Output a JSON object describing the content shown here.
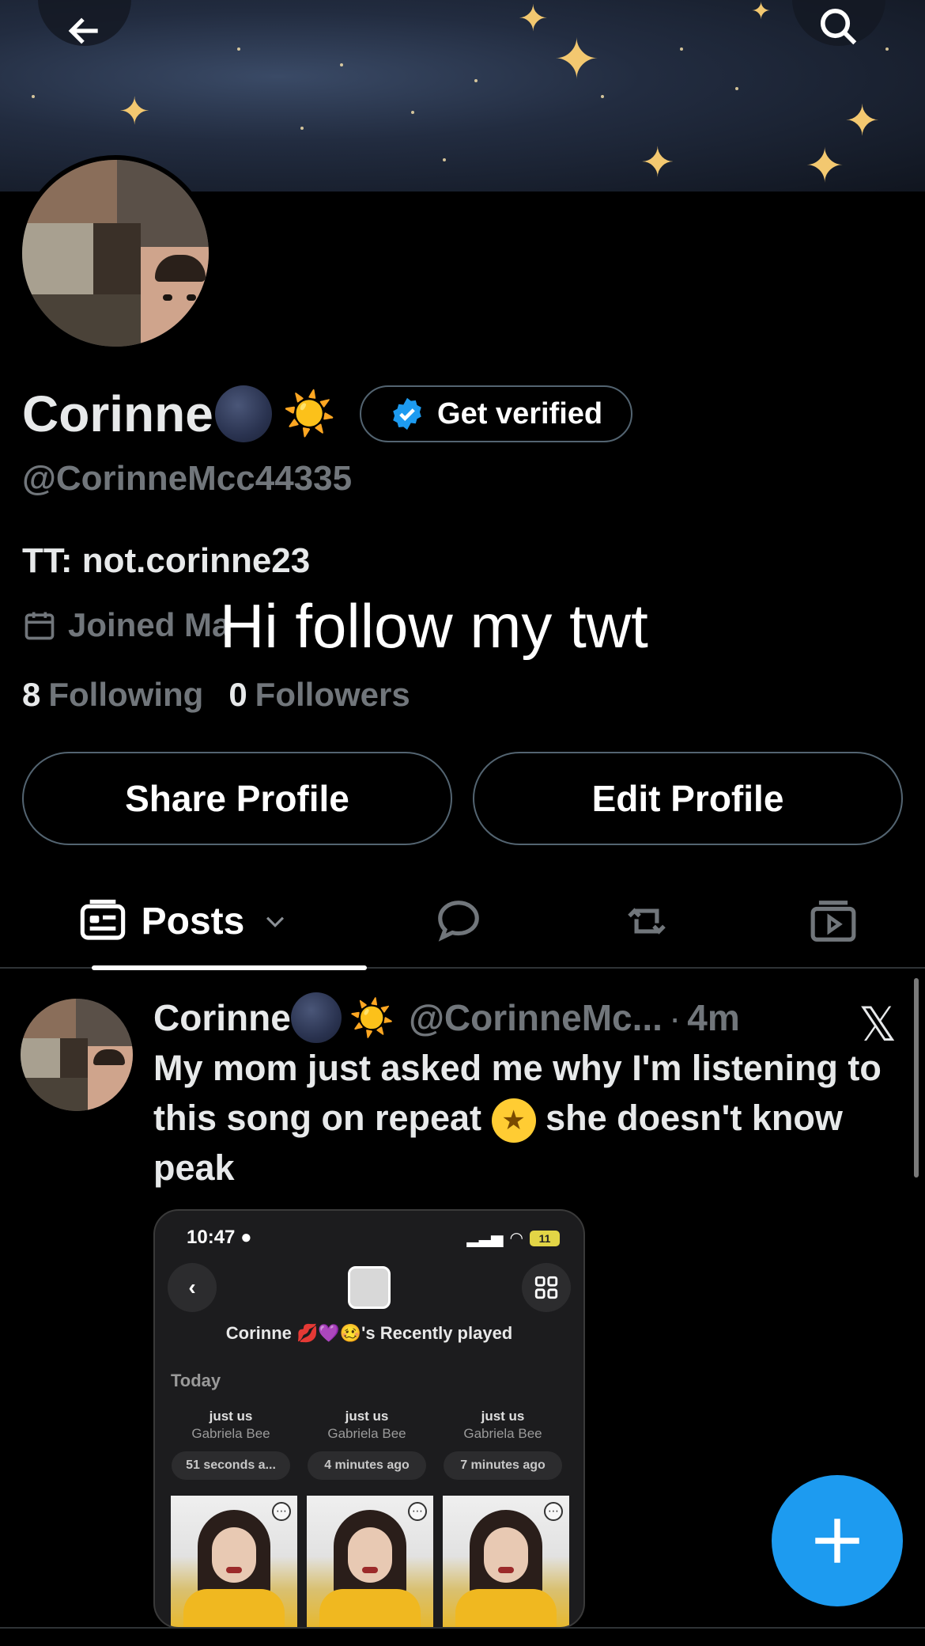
{
  "profile": {
    "name": "Corinne",
    "sun_emoji": "☀️",
    "get_verified_label": "Get verified",
    "handle": "@CorinneMcc44335",
    "bio": "TT: not.corinne23",
    "joined": "Joined Ma",
    "overlay_caption": "Hi follow my twt",
    "following_count": "8",
    "following_label": "Following",
    "followers_count": "0",
    "followers_label": "Followers",
    "share_profile_label": "Share Profile",
    "edit_profile_label": "Edit Profile"
  },
  "tabs": {
    "posts_label": "Posts",
    "icons": [
      "posts-icon",
      "replies-icon",
      "reposts-icon",
      "media-icon"
    ]
  },
  "post": {
    "author_name": "Corinne",
    "sun_emoji": "☀️",
    "handle": "@CorinneMc...",
    "separator": "·",
    "time": "4m",
    "x_logo": "𝕏",
    "text_part1": "My mom just asked me why I'm listening to this song on repeat",
    "emoji": "★",
    "text_part2": "she doesn't know peak",
    "embed": {
      "time": "10:47",
      "battery": "11",
      "title": "Corinne 💋💜🥴's Recently played",
      "section": "Today",
      "items": [
        {
          "song": "just us",
          "artist": "Gabriela Bee",
          "ago": "51 seconds a..."
        },
        {
          "song": "just us",
          "artist": "Gabriela Bee",
          "ago": "4 minutes ago"
        },
        {
          "song": "just us",
          "artist": "Gabriela Bee",
          "ago": "7 minutes ago"
        }
      ]
    }
  },
  "colors": {
    "accent": "#1d9bf0",
    "muted": "#71767b",
    "text": "#e7e9ea",
    "background": "#000000"
  }
}
